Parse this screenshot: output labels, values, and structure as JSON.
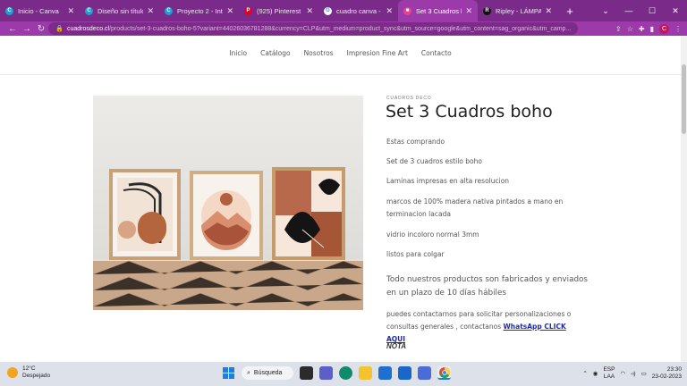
{
  "tabs": [
    {
      "title": "Inicio - Canva",
      "color": "#1da1d4",
      "glyph": "C"
    },
    {
      "title": "Diseño sin título - Po",
      "color": "#1da1d4",
      "glyph": "C"
    },
    {
      "title": "Proyecto 2 - Interior",
      "color": "#1da1d4",
      "glyph": "C"
    },
    {
      "title": "(925) Pinterest",
      "color": "#e60023",
      "glyph": "P"
    },
    {
      "title": "cuadro canva - Goog",
      "color": "#ffffff",
      "glyph": "G"
    },
    {
      "title": "Set 3 Cuadros boho",
      "color": "#e84393",
      "glyph": "■"
    },
    {
      "title": "Ripley - LÁMPARA DI",
      "color": "#111111",
      "glyph": "R"
    }
  ],
  "address": {
    "host": "cuadrosdeco.cl",
    "path": "/products/set-3-cuadros-boho-5?variant=44026036781288&currency=CLP&utm_medium=product_sync&utm_source=google&utm_content=sag_organic&utm_camp..."
  },
  "toolbar": {
    "back": "←",
    "forward": "→",
    "reload": "↻",
    "lock": "🔒",
    "share": "⇪",
    "star": "☆",
    "ext": "✚",
    "side": "▮",
    "profile": "C",
    "menu": "⋮"
  },
  "window": {
    "tabmenu": "⌄",
    "minimize": "—",
    "maximize": "☐",
    "close": "✕"
  },
  "site_nav": [
    "Inicio",
    "Catálogo",
    "Nosotros",
    "Impresion Fine Art",
    "Contacto"
  ],
  "product": {
    "brand": "CUADROS DECO",
    "title": "Set 3 Cuadros boho",
    "lines": [
      "Estas comprando",
      "Set de 3 cuadros estilo boho",
      "Laminas impresas en alta resolucion",
      "marcos de 100% madera nativa pintados a mano en terminacion lacada",
      "vidrio incoloro normal 3mm",
      "listos para colgar"
    ],
    "notice": "Todo nuestros productos son fabricados y enviados en un plazo de 10 días hábiles",
    "contact_text": "puedes contactarnos para solicitar personalizaciones o consultas generales , contactanos ",
    "contact_link": "WhatsApp CLICK AQUI",
    "nota": "NOTA"
  },
  "taskbar": {
    "temp": "12°C",
    "weather": "Despejado",
    "search_label": "Búsqueda",
    "lang1": "ESP",
    "lang2": "LAA",
    "time": "23:30",
    "date": "23-02-2023"
  }
}
